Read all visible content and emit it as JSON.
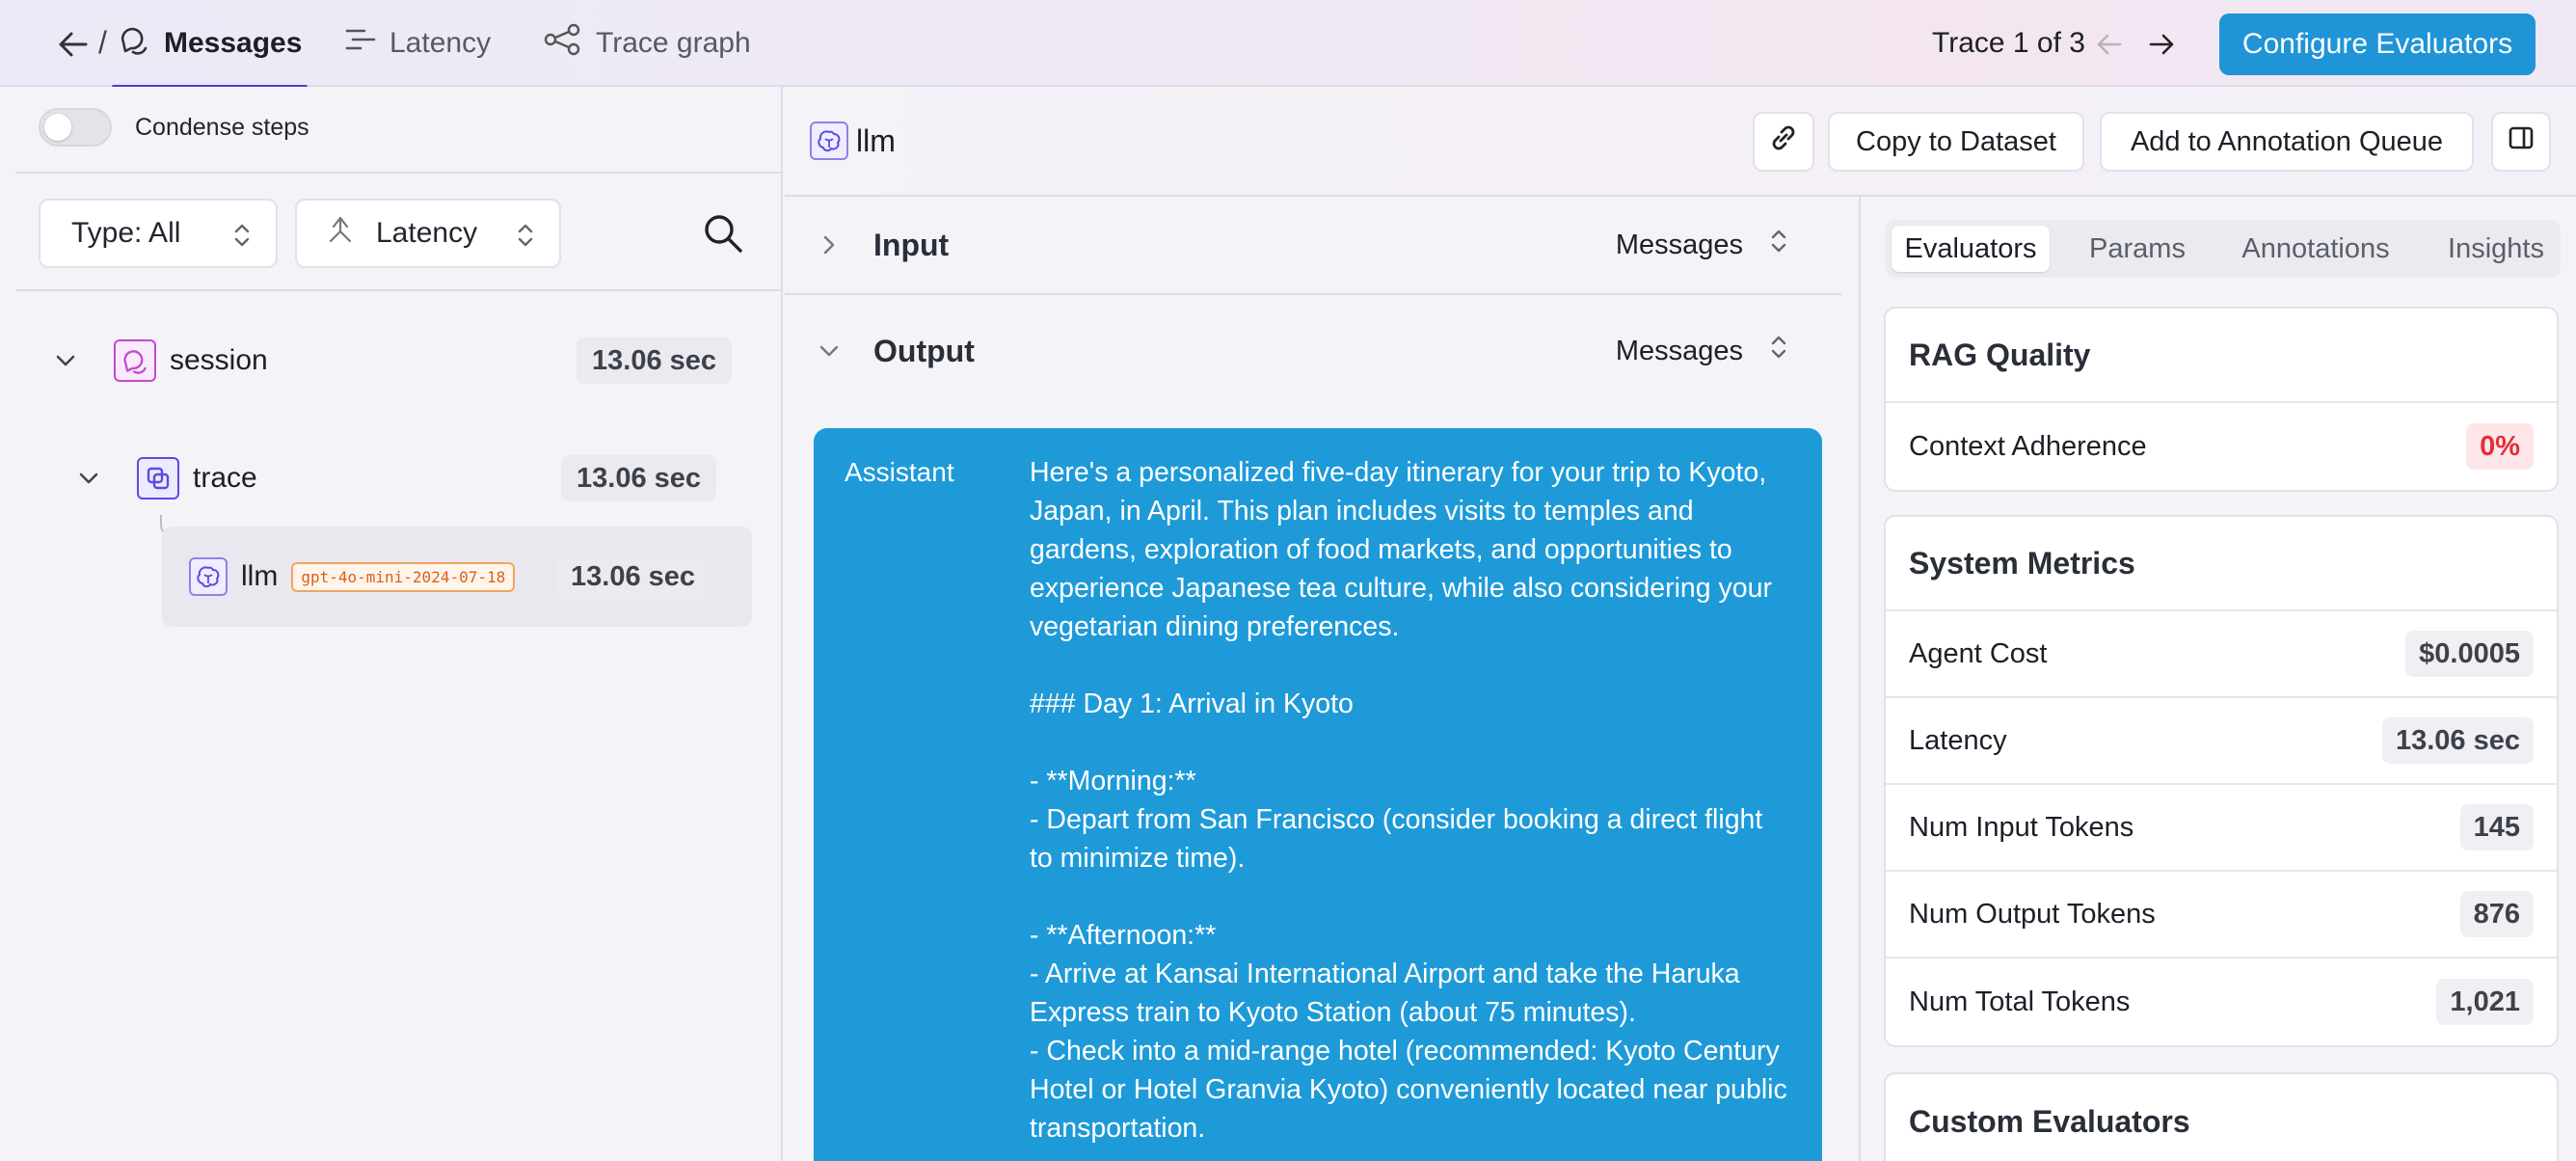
{
  "nav": {
    "tabs": [
      {
        "label": "Messages",
        "icon": "chat-bubbles-icon"
      },
      {
        "label": "Latency",
        "icon": "waterfall-lines-icon"
      },
      {
        "label": "Trace graph",
        "icon": "graph-nodes-icon"
      }
    ],
    "trace_counter": "Trace 1 of 3",
    "configure_button": "Configure Evaluators"
  },
  "left_panel": {
    "condense_label": "Condense steps",
    "type_filter": "Type: All",
    "sort_filter": "Latency",
    "tree": [
      {
        "label": "session",
        "duration": "13.06 sec"
      },
      {
        "label": "trace",
        "duration": "13.06 sec"
      },
      {
        "label": "llm",
        "model": "gpt-4o-mini-2024-07-18",
        "duration": "13.06 sec"
      }
    ]
  },
  "detail": {
    "title": "llm",
    "copy_button": "Copy to Dataset",
    "annotation_button": "Add to Annotation Queue",
    "input": {
      "title": "Input",
      "view": "Messages"
    },
    "output": {
      "title": "Output",
      "view": "Messages"
    },
    "message": {
      "role": "Assistant",
      "text": "Here's a personalized five-day itinerary for your trip to Kyoto, Japan, in April. This plan includes visits to temples and gardens, exploration of food markets, and opportunities to experience Japanese tea culture, while also considering your vegetarian dining preferences.\n\n### Day 1: Arrival in Kyoto\n\n- **Morning:**\n- Depart from San Francisco (consider booking a direct flight to minimize time).\n\n- **Afternoon:**\n- Arrive at Kansai International Airport and take the Haruka Express train to Kyoto Station (about 75 minutes).\n- Check into a mid-range hotel (recommended: Kyoto Century Hotel or Hotel Granvia Kyoto) conveniently located near public transportation."
    }
  },
  "right_panel": {
    "tabs": [
      "Evaluators",
      "Params",
      "Annotations",
      "Insights"
    ],
    "rag_quality": {
      "title": "RAG Quality",
      "metrics": [
        {
          "label": "Context Adherence",
          "value": "0%"
        }
      ]
    },
    "system_metrics": {
      "title": "System Metrics",
      "metrics": [
        {
          "label": "Agent Cost",
          "value": "$0.0005"
        },
        {
          "label": "Latency",
          "value": "13.06 sec"
        },
        {
          "label": "Num Input Tokens",
          "value": "145"
        },
        {
          "label": "Num Output Tokens",
          "value": "876"
        },
        {
          "label": "Num Total Tokens",
          "value": "1,021"
        }
      ]
    },
    "custom_evaluators": {
      "title": "Custom Evaluators"
    }
  },
  "colors": {
    "accent": "#1f94d6",
    "tab_underline": "#4b3fd6",
    "message_bg": "#1e9ad8",
    "bad_value": "#e0303a"
  }
}
